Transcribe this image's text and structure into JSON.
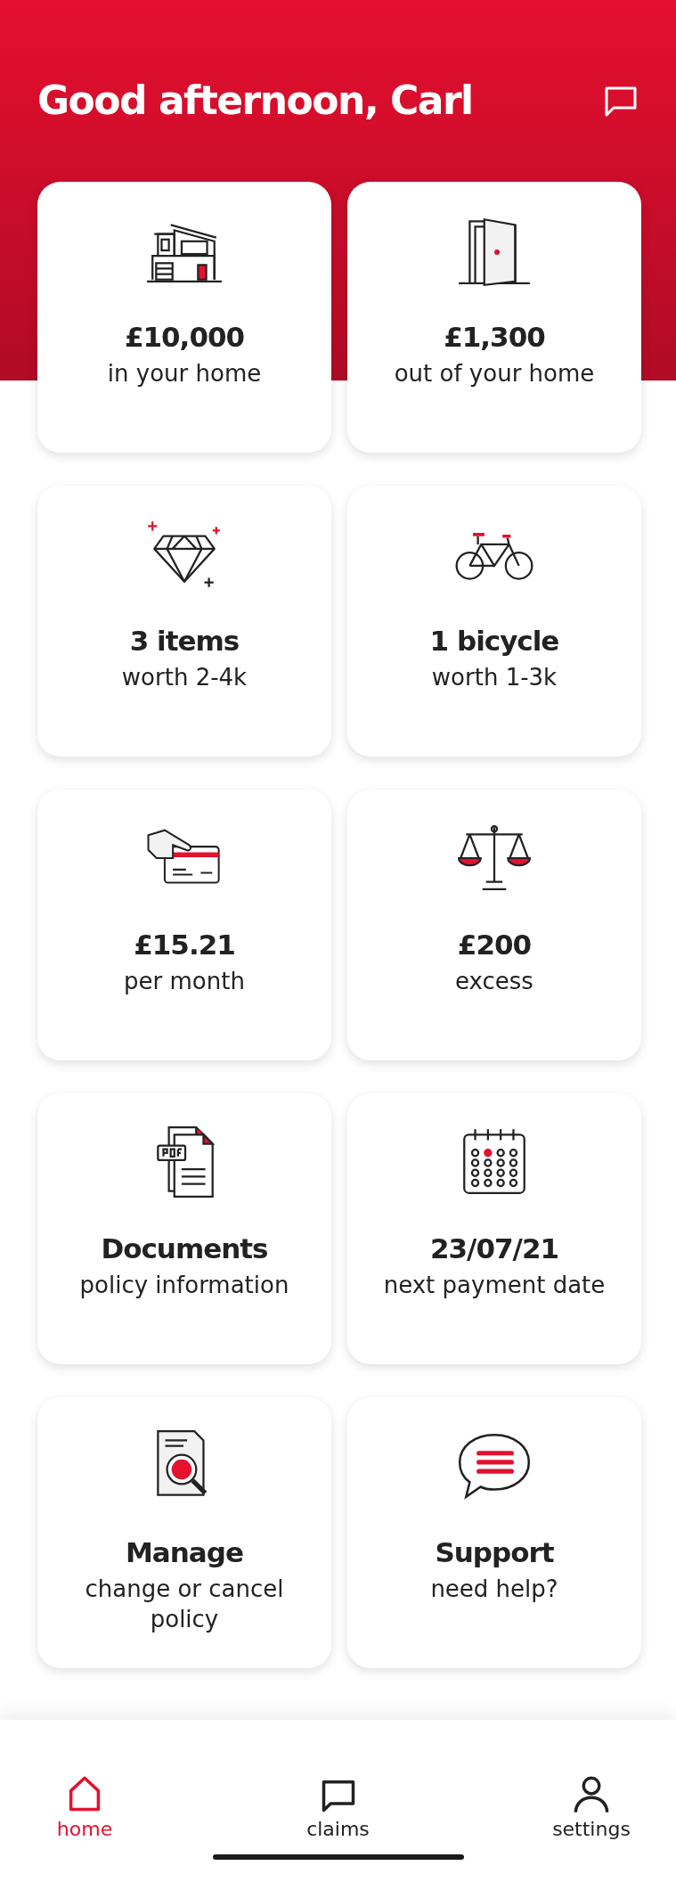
{
  "header": {
    "greeting": "Good afternoon, Carl"
  },
  "cards": [
    {
      "kind": "house",
      "value": "£10,000",
      "caption": "in your home"
    },
    {
      "kind": "door",
      "value": "£1,300",
      "caption": "out of your home"
    },
    {
      "kind": "diamond",
      "value": "3 items",
      "caption": "worth 2-4k"
    },
    {
      "kind": "bicycle",
      "value": "1 bicycle",
      "caption": "worth 1-3k"
    },
    {
      "kind": "card",
      "value": "£15.21",
      "caption": "per month"
    },
    {
      "kind": "scales",
      "value": "£200",
      "caption": "excess"
    },
    {
      "kind": "pdf",
      "value": "Documents",
      "caption": "policy information"
    },
    {
      "kind": "calendar",
      "value": "23/07/21",
      "caption": "next payment date"
    },
    {
      "kind": "search",
      "value": "Manage",
      "caption": "change or cancel policy"
    },
    {
      "kind": "chat",
      "value": "Support",
      "caption": "need help?"
    }
  ],
  "nav": [
    {
      "kind": "home",
      "label": "home",
      "selected": true
    },
    {
      "kind": "claims",
      "label": "claims",
      "selected": false
    },
    {
      "kind": "settings",
      "label": "settings",
      "selected": false
    }
  ]
}
